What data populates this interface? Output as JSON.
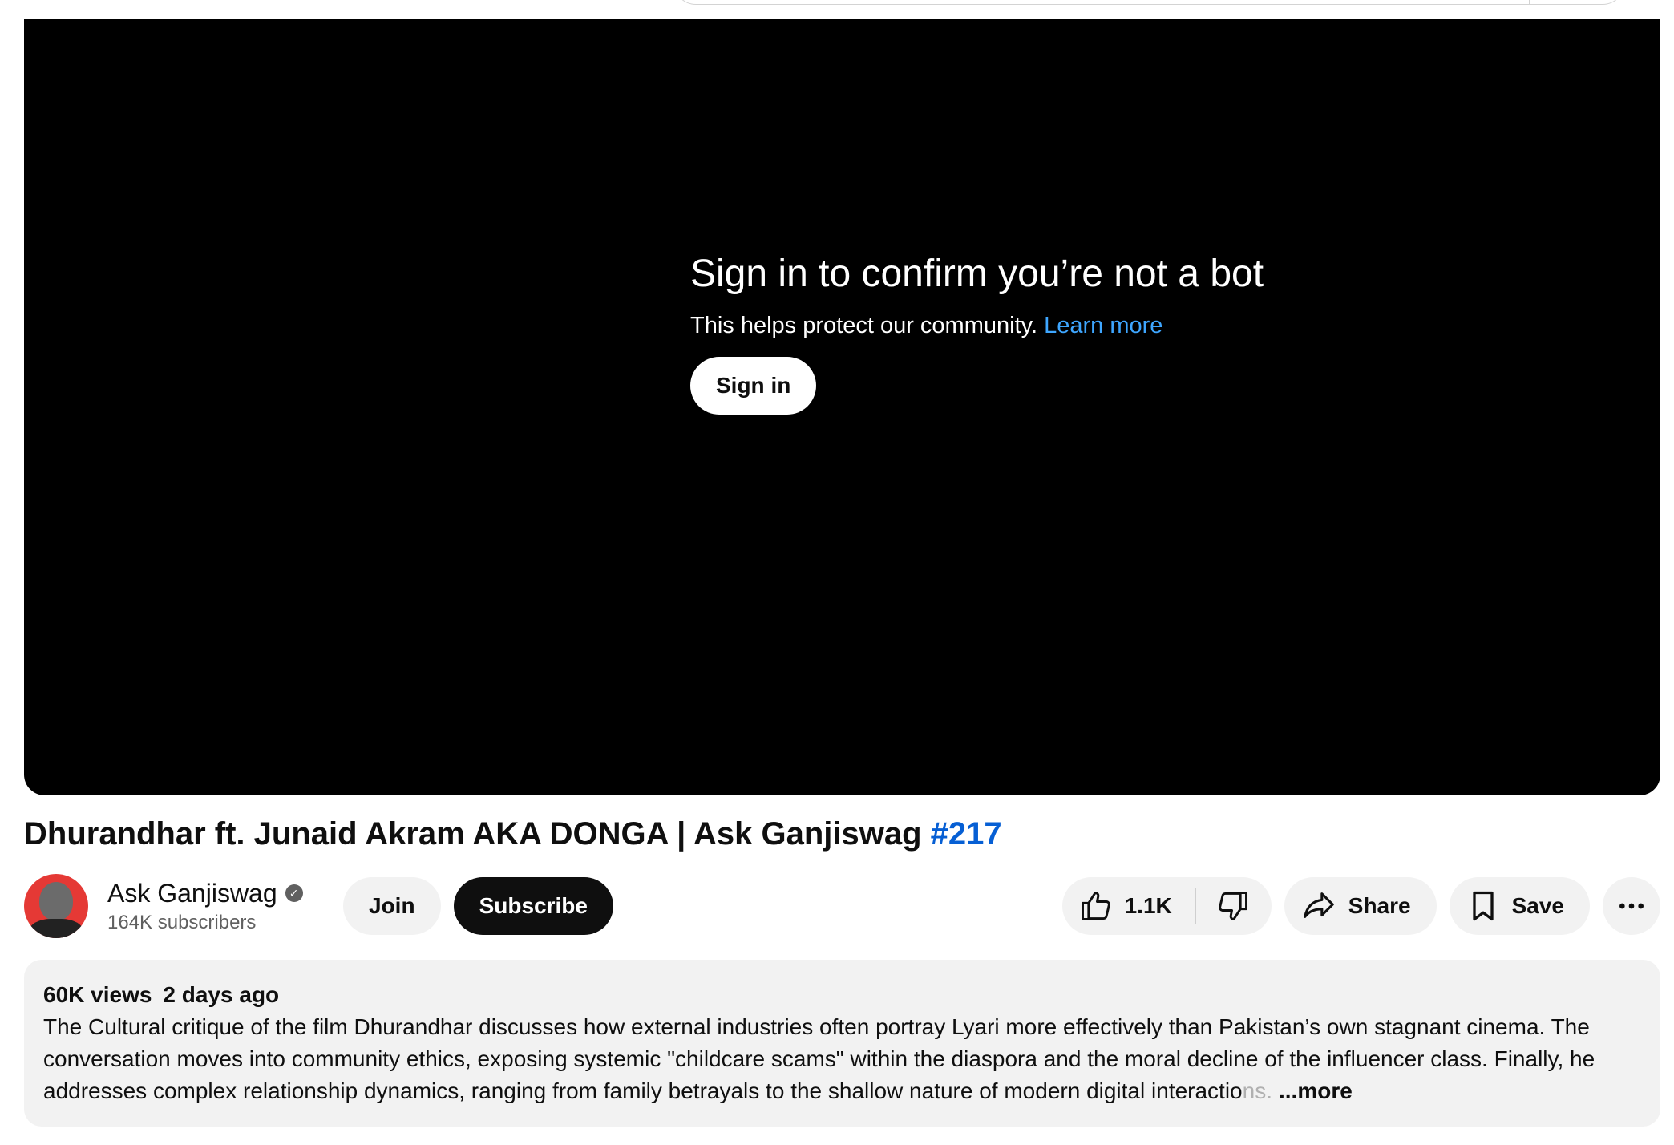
{
  "player": {
    "bot_title": "Sign in to confirm you’re not a bot",
    "bot_subtitle": "This helps protect our community.",
    "learn_more": "Learn more",
    "signin_label": "Sign in"
  },
  "video": {
    "title": "Dhurandhar ft. Junaid Akram AKA DONGA | Ask Ganjiswag",
    "hashtag": "#217"
  },
  "channel": {
    "name": "Ask Ganjiswag",
    "subscribers": "164K subscribers",
    "join_label": "Join",
    "subscribe_label": "Subscribe"
  },
  "actions": {
    "like_count": "1.1K",
    "share_label": "Share",
    "save_label": "Save",
    "icons": [
      "thumbs-up-icon",
      "thumbs-down-icon",
      "share-arrow-icon",
      "bookmark-icon",
      "more-horizontal-icon"
    ]
  },
  "description": {
    "views": "60K views",
    "date": "2 days ago",
    "text": "The Cultural critique of the film Dhurandhar discusses how external industries often portray Lyari more effectively than Pakistan’s own stagnant cinema. The conversation moves into community ethics, exposing systemic \"childcare scams\" within the diaspora and the moral decline of the influencer class. Finally, he addresses complex relationship dynamics, ranging from family betrayals to the shallow nature of modern digital interactio",
    "text_faded": "ns.",
    "more_label": "...more"
  },
  "colors": {
    "link_blue": "#3ea6ff",
    "hashtag_blue": "#065fd4",
    "subscribe_bg": "#0f0f0f",
    "pill_bg": "#f2f2f2"
  }
}
